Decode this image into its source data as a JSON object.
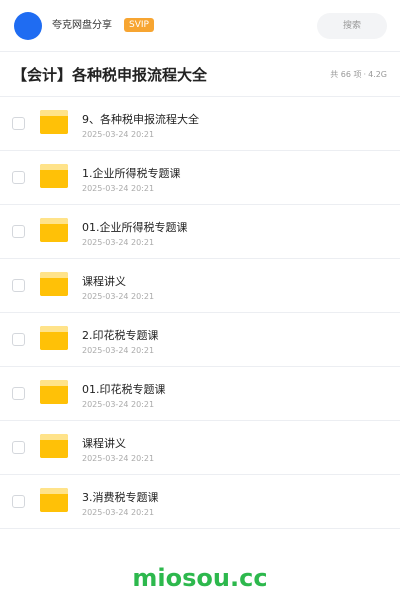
{
  "header": {
    "share_name": "夸克网盘分享",
    "badge": "SVIP",
    "search_label": "搜索"
  },
  "title_bar": {
    "title": "【会计】各种税申报流程大全",
    "count": "共 66 项",
    "separator": "·",
    "size": "4.2G"
  },
  "files": [
    {
      "name": "9、各种税申报流程大全",
      "date": "2025-03-24 20:21",
      "icon": "folder-icon"
    },
    {
      "name": "1.企业所得税专题课",
      "date": "2025-03-24 20:21",
      "icon": "folder-icon"
    },
    {
      "name": "01.企业所得税专题课",
      "date": "2025-03-24 20:21",
      "icon": "folder-icon"
    },
    {
      "name": "课程讲义",
      "date": "2025-03-24 20:21",
      "icon": "folder-icon"
    },
    {
      "name": "2.印花税专题课",
      "date": "2025-03-24 20:21",
      "icon": "folder-icon"
    },
    {
      "name": "01.印花税专题课",
      "date": "2025-03-24 20:21",
      "icon": "folder-icon"
    },
    {
      "name": "课程讲义",
      "date": "2025-03-24 20:21",
      "icon": "folder-icon"
    },
    {
      "name": "3.消费税专题课",
      "date": "2025-03-24 20:21",
      "icon": "folder-icon"
    }
  ],
  "watermark": "miosou.cc",
  "colors": {
    "avatar": "#1f6cf2",
    "badge": "#f7a531",
    "folder": "#ffc107",
    "watermark": "#2db84d"
  }
}
